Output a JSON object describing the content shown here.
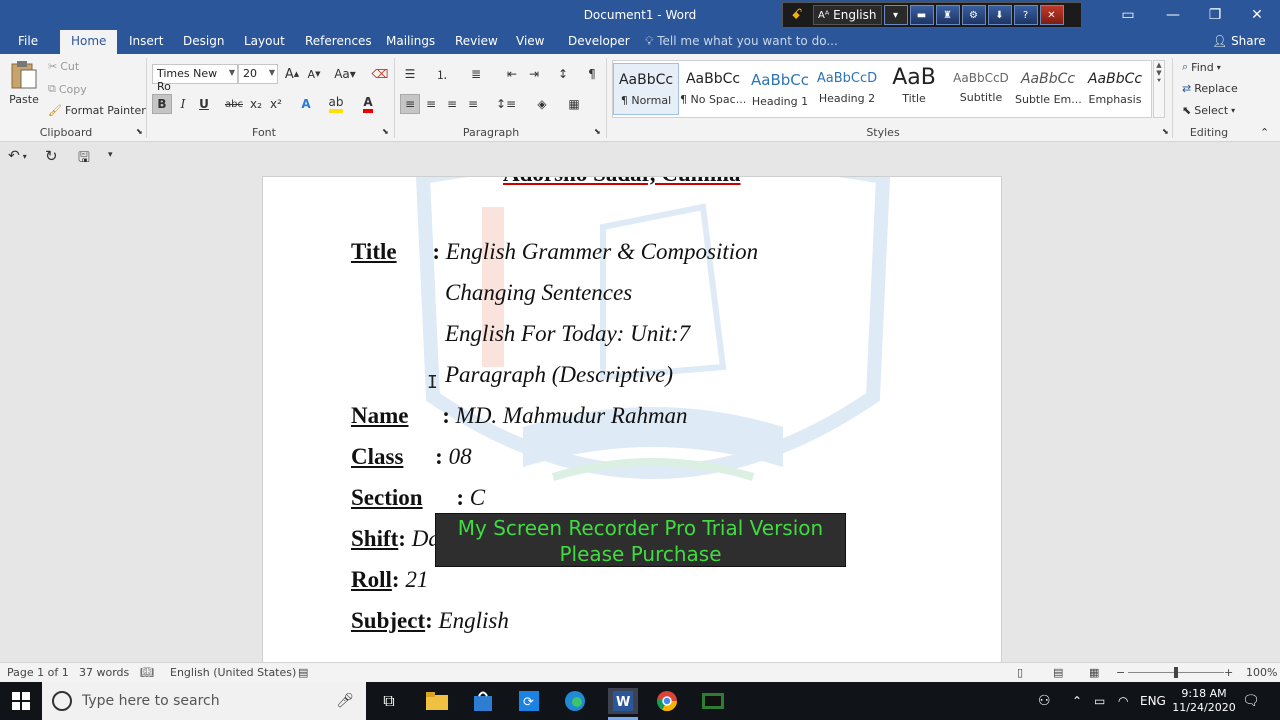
{
  "titlebar": {
    "title": "Document1 - Word"
  },
  "recorder_toolbar": {
    "language": "English"
  },
  "tabs": [
    {
      "label": "File"
    },
    {
      "label": "Home"
    },
    {
      "label": "Insert"
    },
    {
      "label": "Design"
    },
    {
      "label": "Layout"
    },
    {
      "label": "References"
    },
    {
      "label": "Mailings"
    },
    {
      "label": "Review"
    },
    {
      "label": "View"
    },
    {
      "label": "Developer"
    }
  ],
  "tell_me": "Tell me what you want to do...",
  "share": "Share",
  "clipboard": {
    "paste": "Paste",
    "cut": "Cut",
    "copy": "Copy",
    "format_painter": "Format Painter",
    "label": "Clipboard"
  },
  "font": {
    "family": "Times New Ro",
    "size": "20",
    "label": "Font",
    "case_btn": "Aa",
    "grow": "A",
    "shrink": "A",
    "bold": "B",
    "italic": "I",
    "underline": "U",
    "strike": "abc",
    "sub": "x₂",
    "sup": "x²"
  },
  "paragraph": {
    "label": "Paragraph"
  },
  "styles": {
    "label": "Styles",
    "items": [
      {
        "sample": "AaBbCc",
        "name": "¶ Normal"
      },
      {
        "sample": "AaBbCc",
        "name": "¶ No Spac..."
      },
      {
        "sample": "AaBbCc",
        "name": "Heading 1"
      },
      {
        "sample": "AaBbCcD",
        "name": "Heading 2"
      },
      {
        "sample": "AaB",
        "name": "Title"
      },
      {
        "sample": "AaBbCcD",
        "name": "Subtitle"
      },
      {
        "sample": "AaBbCc",
        "name": "Subtle Em..."
      },
      {
        "sample": "AaBbCc",
        "name": "Emphasis"
      }
    ]
  },
  "editing": {
    "find": "Find",
    "replace": "Replace",
    "select": "Select",
    "label": "Editing"
  },
  "document": {
    "header_cut": "Adorsho Sadar, Cumilla",
    "title_label": "Title",
    "title_lines": [
      "English Grammer & Composition",
      "Changing Sentences",
      "English For Today: Unit:7",
      "Paragraph (Descriptive)"
    ],
    "name_label": "Name",
    "name_value": "MD. Mahmudur Rahman",
    "class_label": "Class",
    "class_value": "08",
    "section_label": "Section",
    "section_value": "C",
    "shift_label": "Shift",
    "shift_value": "Day",
    "roll_label": "Roll",
    "roll_value": "21",
    "subject_label": "Subject",
    "subject_value": "English",
    "colon": ":"
  },
  "recorder_banner": {
    "line1": "My Screen Recorder Pro Trial Version",
    "line2": "Please Purchase"
  },
  "statusbar": {
    "page": "Page 1 of 1",
    "words": "37 words",
    "language": "English (United States)",
    "zoom": "100%",
    "zoom_level": 1.0
  },
  "taskbar": {
    "search_placeholder": "Type here to search",
    "lang": "ENG",
    "time": "9:18 AM",
    "date": "11/24/2020"
  },
  "colors": {
    "word_blue": "#2b579a",
    "banner_text": "#3fdc3f"
  }
}
